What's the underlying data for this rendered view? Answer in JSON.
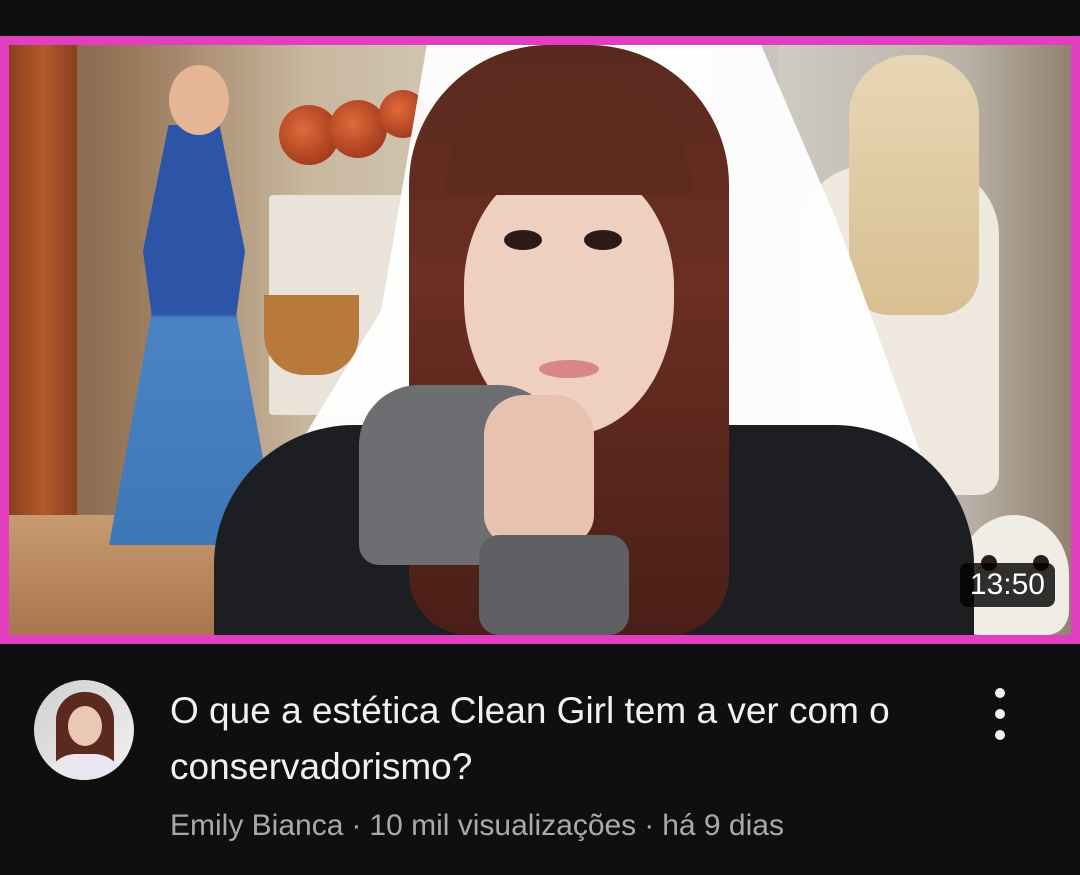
{
  "video": {
    "duration": "13:50",
    "title": "O que a estética Clean Girl tem a ver com o conservadorismo?",
    "channel": "Emily Bianca",
    "views": "10 mil visualizações",
    "age": "há 9 dias"
  },
  "colors": {
    "background": "#0f0f0f",
    "thumbnail_border": "#e13fbf",
    "title_text": "#f1f1f1",
    "meta_text": "#aaaaaa"
  },
  "icons": {
    "menu": "more-vert-icon"
  }
}
